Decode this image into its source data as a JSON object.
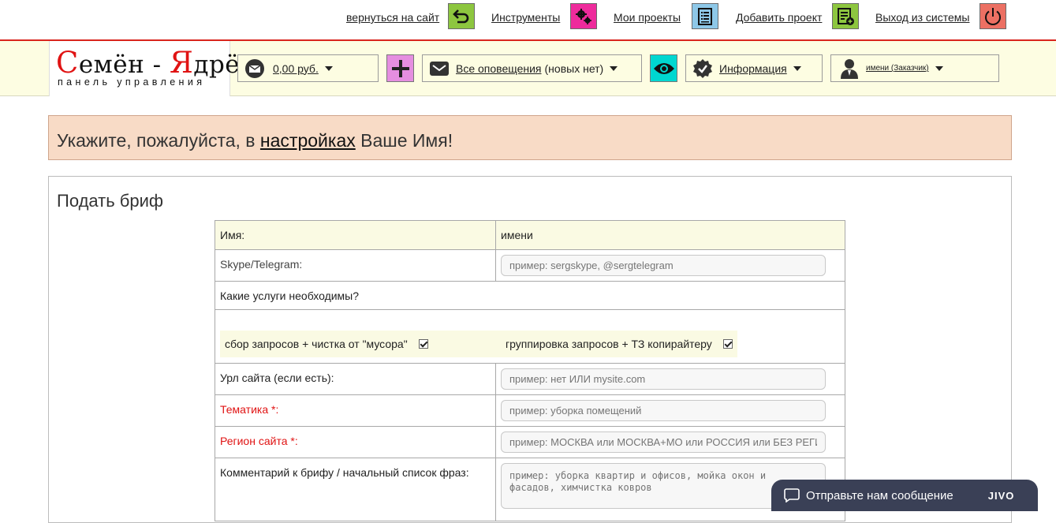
{
  "topnav": {
    "items": [
      {
        "label": "вернуться на сайт",
        "icon": "back-arrow-icon",
        "color": "#8dc63f"
      },
      {
        "label": "Инструменты",
        "icon": "gears-icon",
        "color": "#ee2b9c"
      },
      {
        "label": "Мои проекты",
        "icon": "list-icon",
        "color": "#8ec8e8"
      },
      {
        "label": "Добавить проект",
        "icon": "add-list-icon",
        "color": "#8dc63f"
      },
      {
        "label": "Выход из системы",
        "icon": "power-icon",
        "color": "#ec7063"
      }
    ]
  },
  "logo": {
    "first": "С",
    "first_rest": "емён",
    "dash": " - ",
    "second": "Я",
    "second_rest": "дрён",
    "subtitle": "панель управления"
  },
  "header": {
    "balance": "0,00 руб.",
    "add_color": "#e58ee0",
    "notifications_label": "Все оповещения",
    "notifications_count": "(новых нет)",
    "eye_color": "#00d7d0",
    "info_label": "Информация",
    "user_label": "имени (Заказчик)"
  },
  "alert": {
    "prefix": "Укажите, пожалуйста, в ",
    "link": "настройках",
    "suffix": " Ваше Имя!"
  },
  "brief": {
    "title": "Подать бриф",
    "name_label": "Имя:",
    "name_value": "имени",
    "skype_label": "Skype/Telegram:",
    "skype_placeholder": "пример: sergskype, @sergtelegram",
    "services_label": "Какие услуги необходимы?",
    "service1": "сбор запросов + чистка от \"мусора\"",
    "service2": "группировка запросов + ТЗ копирайтеру",
    "url_label": "Урл сайта (если есть):",
    "url_placeholder": "пример: нет ИЛИ mysite.com",
    "topic_label": "Тематика *:",
    "topic_placeholder": "пример: уборка помещений",
    "region_label": "Регион сайта *:",
    "region_placeholder": "пример: МОСКВА или МОСКВА+МО или РОССИЯ или БЕЗ РЕГИОНА",
    "comment_label": "Комментарий к брифу / начальный список фраз:",
    "comment_placeholder": "пример: уборка квартир и офисов, мойка окон и фасадов, химчистка ковров"
  },
  "chat": {
    "label": "Отправьте нам сообщение",
    "brand": "JIVO"
  }
}
